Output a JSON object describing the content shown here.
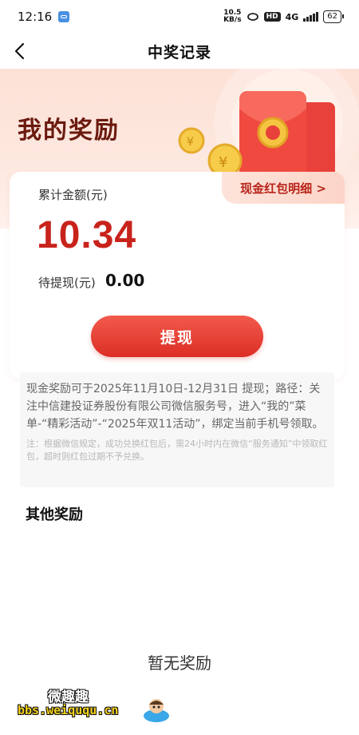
{
  "status_bar": {
    "time": "12:16",
    "net_speed_value": "10.5",
    "net_speed_unit": "KB/s",
    "hd": "HD",
    "network": "4G",
    "battery": "62"
  },
  "nav": {
    "title": "中奖记录"
  },
  "hero": {
    "title": "我的奖励"
  },
  "card": {
    "detail_link": "现金红包明细 >",
    "total_label": "累计金额(元)",
    "total_value": "10.34",
    "pending_label": "待提现(元)",
    "pending_value": "0.00",
    "withdraw_button": "提现"
  },
  "notice": {
    "main": "现金奖励可于2025年11月10日-12月31日 提现；路径：关注中信建投证券股份有限公司微信服务号，进入“我的”菜单-“精彩活动”-“2025年双11活动”，绑定当前手机号领取。",
    "note": "注：根据微信规定，成功兑换红包后，需24小时内在微信“服务通知”中领取红包，超时则红包过期不予兑换。"
  },
  "other": {
    "title": "其他奖励",
    "empty": "暂无奖励"
  },
  "watermark": {
    "name": "微趣趣",
    "url": "bbs.weiququ.cn"
  },
  "colors": {
    "accent_red": "#dc2e25",
    "amount_red": "#c8231b",
    "hero_bg": "#fde1d6"
  }
}
